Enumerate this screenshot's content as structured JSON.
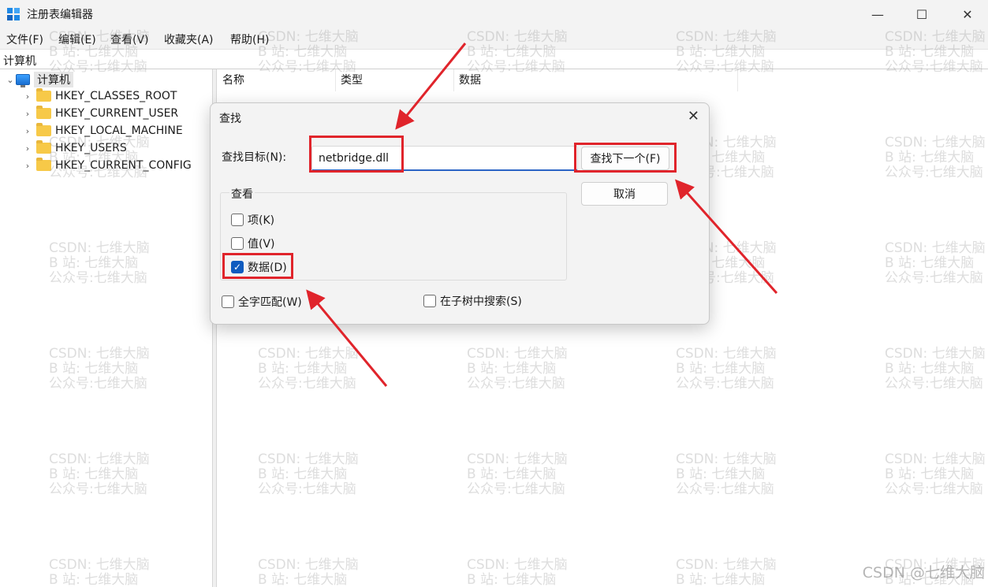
{
  "window": {
    "title": "注册表编辑器",
    "minimize_glyph": "—",
    "maximize_glyph": "☐",
    "close_glyph": "✕"
  },
  "menu": [
    "文件(F)",
    "编辑(E)",
    "查看(V)",
    "收藏夹(A)",
    "帮助(H)"
  ],
  "address": "计算机",
  "tree": {
    "root": "计算机",
    "items": [
      "HKEY_CLASSES_ROOT",
      "HKEY_CURRENT_USER",
      "HKEY_LOCAL_MACHINE",
      "HKEY_USERS",
      "HKEY_CURRENT_CONFIG"
    ]
  },
  "list_columns": [
    "名称",
    "类型",
    "数据"
  ],
  "dialog": {
    "title": "查找",
    "close_glyph": "✕",
    "find_label": "查找目标(N):",
    "find_value": "netbridge.dll",
    "find_next_label": "查找下一个(F)",
    "cancel_label": "取消",
    "look_at_label": "查看",
    "options": [
      {
        "label": "项(K)",
        "checked": false
      },
      {
        "label": "值(V)",
        "checked": false
      },
      {
        "label": "数据(D)",
        "checked": true
      }
    ],
    "match_whole_label": "全字匹配(W)",
    "match_whole_checked": false,
    "search_subtree_label": "在子树中搜索(S)",
    "search_subtree_checked": false
  },
  "watermark": {
    "line1": "CSDN: 七维大脑",
    "line2": "B 站: 七维大脑",
    "line3": "公众号:七维大脑",
    "corner": "CSDN @七维大脑"
  },
  "colors": {
    "highlight": "#e0242b",
    "accent": "#0f5bbf"
  }
}
